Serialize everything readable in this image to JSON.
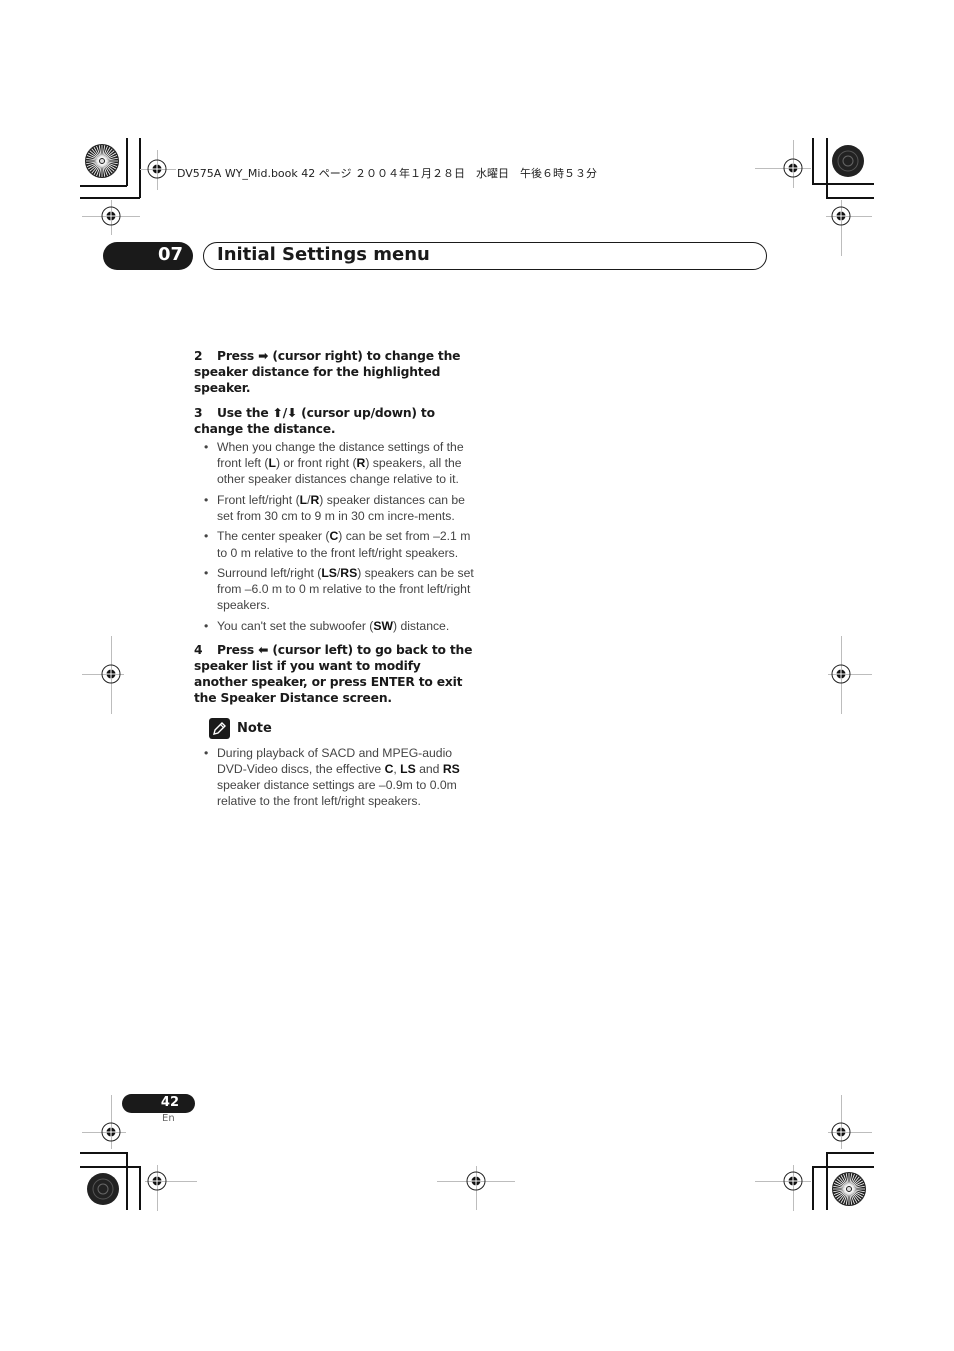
{
  "print_header": "DV575A WY_Mid.book  42 ページ  ２００４年１月２８日　水曜日　午後６時５３分",
  "chapter": {
    "number": "07",
    "title": "Initial Settings menu"
  },
  "steps": [
    {
      "number": "2",
      "text_before": "Press ",
      "arrow": "➡",
      "text_after": " (cursor right) to change the speaker distance for the highlighted speaker."
    },
    {
      "number": "3",
      "text_before": "Use the ",
      "arrow": "⬆/⬇",
      "text_after": " (cursor up/down) to change the distance."
    },
    {
      "number": "4",
      "text_before": "Press ",
      "arrow": "⬅",
      "text_after": " (cursor left) to go back to the speaker list if you want to modify another speaker, or press ENTER to exit the Speaker Distance screen."
    }
  ],
  "step3_bullets": [
    {
      "parts": [
        "When you change the distance settings of the front left (",
        "L",
        ") or front right (",
        "R",
        ") speakers, all the other speaker distances change relative to it."
      ]
    },
    {
      "parts": [
        "Front left/right (",
        "L",
        "/",
        "R",
        ") speaker distances can be set from 30 cm to 9 m in 30 cm incre-ments."
      ]
    },
    {
      "parts": [
        "The center speaker (",
        "C",
        ") can be set from –2.1 m to 0 m relative to the front left/right speakers."
      ]
    },
    {
      "parts": [
        "Surround left/right (",
        "LS",
        "/",
        "RS",
        ") speakers can be set from –6.0 m to 0 m relative to the front left/right speakers."
      ]
    },
    {
      "parts": [
        "You can't set the subwoofer (",
        "SW",
        ") distance."
      ]
    }
  ],
  "note": {
    "icon": "pencil-icon",
    "label": "Note",
    "bullets": [
      {
        "parts": [
          "During playback of SACD and MPEG-audio DVD-Video discs, the effective ",
          "C",
          ", ",
          "LS",
          " and ",
          "RS",
          " speaker distance settings are –0.9m to 0.0m relative to the front left/right speakers."
        ]
      }
    ]
  },
  "footer": {
    "page_number": "42",
    "language": "En"
  },
  "bullet_glyph": "•"
}
